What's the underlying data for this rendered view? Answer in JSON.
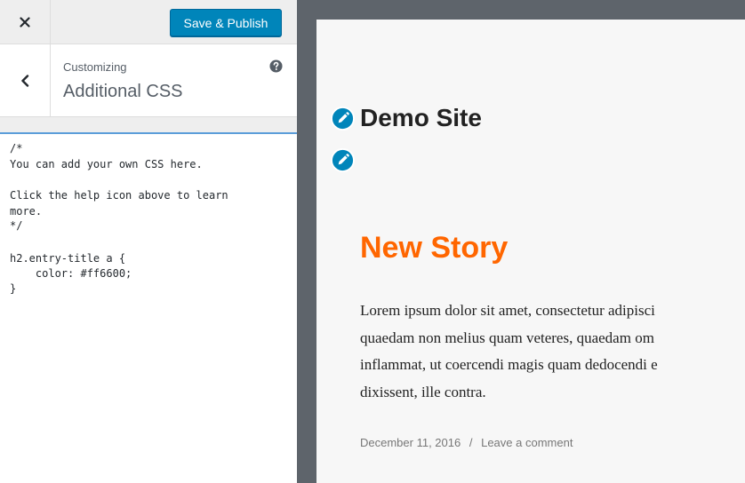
{
  "sidebar": {
    "publish_label": "Save & Publish",
    "section_subtitle": "Customizing",
    "section_title": "Additional CSS",
    "css_lines": [
      "/*",
      "You can add your own CSS here.",
      "",
      "Click the help icon above to learn",
      "more.",
      "*/",
      "",
      "h2.entry-title a {",
      "    color: #ff6600;",
      "}"
    ]
  },
  "preview": {
    "site_title": "Demo Site",
    "entry_title": "New Story",
    "entry_lines": [
      "Lorem ipsum dolor sit amet, consectetur adipisci",
      "quaedam non melius quam veteres, quaedam om",
      "inflammat, ut coercendi magis quam dedocendi e",
      "dixissent, ille contra."
    ],
    "entry_date": "December 11, 2016",
    "meta_separator": "/",
    "comment_link": "Leave a comment"
  },
  "icons": {
    "close": "close-icon",
    "back": "chevron-left-icon",
    "help": "question-circle-icon",
    "edit": "pencil-icon"
  },
  "colors": {
    "publish_button": "#0085ba",
    "entry_title": "#ff6600",
    "edit_shortcut": "#0085ba",
    "preview_frame": "#5e646b",
    "focus_border": "#5b9dd9"
  }
}
